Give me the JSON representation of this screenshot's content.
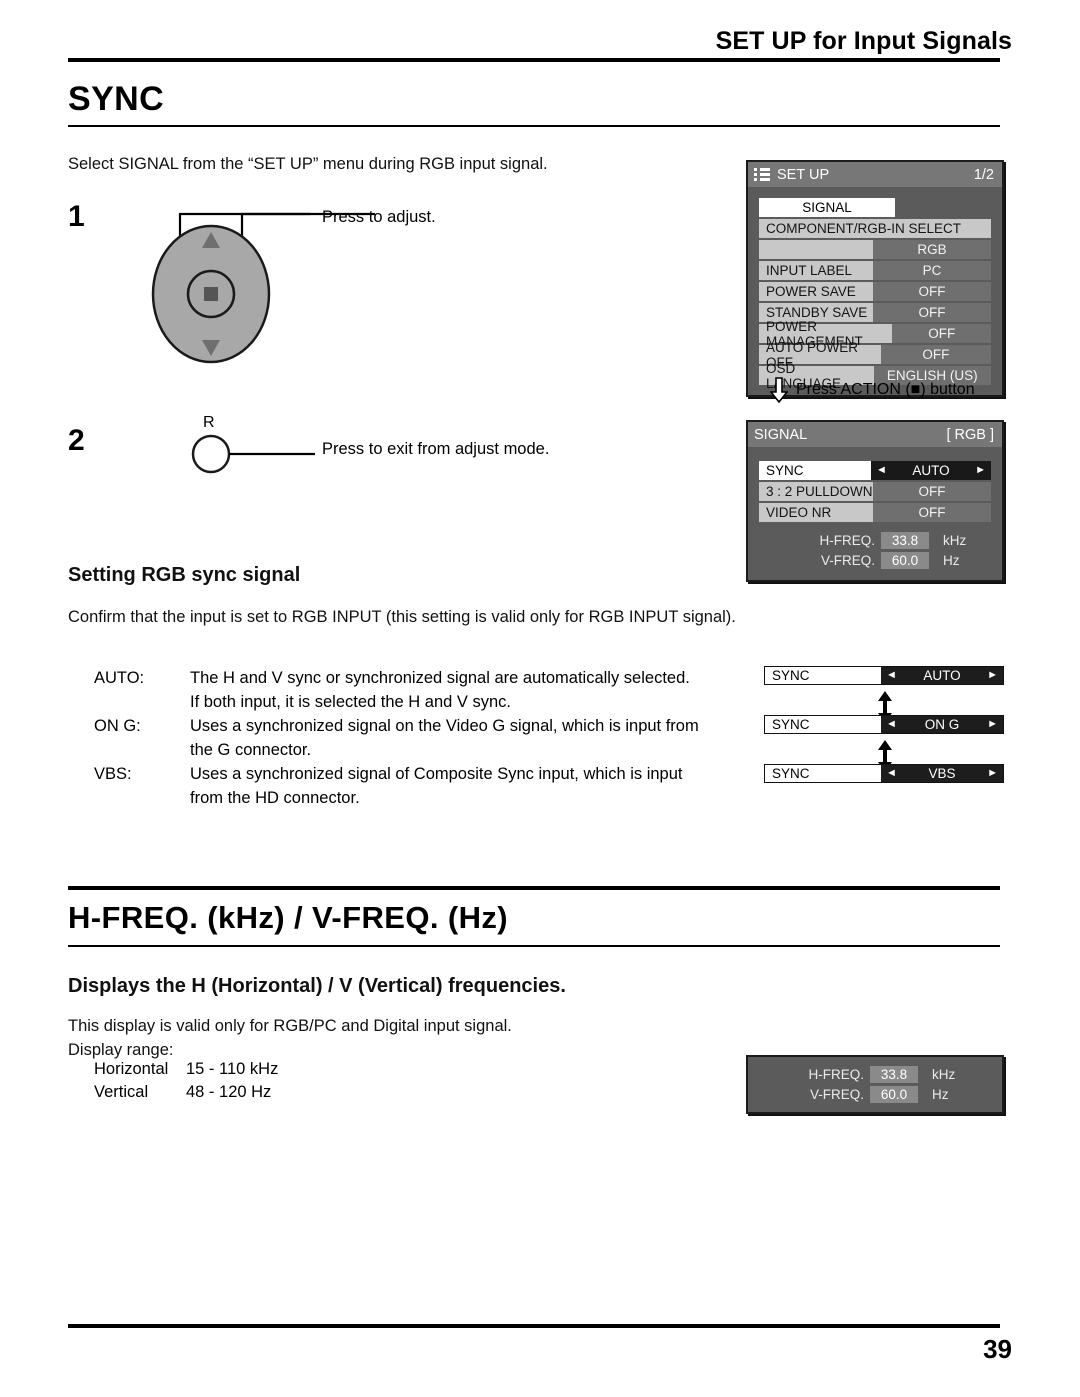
{
  "header": {
    "title": "SET UP for Input Signals"
  },
  "section1": {
    "title": "SYNC",
    "intro": "Select SIGNAL from the “SET UP” menu during RGB input signal.",
    "steps": [
      {
        "number": "1",
        "callout": "Press to adjust."
      },
      {
        "number": "2",
        "callout": "Press to exit from adjust mode.",
        "button_label": "R"
      }
    ]
  },
  "setup_menu": {
    "icon": "list-menu-icon",
    "title": "SET UP",
    "page_indicator": "1/2",
    "highlight_row": "SIGNAL",
    "rows": [
      {
        "label": "COMPONENT/RGB-IN SELECT",
        "value": ""
      },
      {
        "label": "",
        "value": "RGB"
      },
      {
        "label": "INPUT LABEL",
        "value": "PC"
      },
      {
        "label": "POWER SAVE",
        "value": "OFF"
      },
      {
        "label": "STANDBY SAVE",
        "value": "OFF"
      },
      {
        "label": "POWER MANAGEMENT",
        "value": "OFF"
      },
      {
        "label": "AUTO POWER OFF",
        "value": "OFF"
      },
      {
        "label": "OSD LANGUAGE",
        "value": "ENGLISH (US)"
      }
    ]
  },
  "action_note": {
    "arrow": "down-arrow-icon",
    "text": "Press ACTION (■) button"
  },
  "signal_menu": {
    "title": "SIGNAL",
    "input_tag": "[ RGB ]",
    "rows": [
      {
        "label": "SYNC",
        "value": "AUTO",
        "selected": true
      },
      {
        "label": "3 : 2 PULLDOWN",
        "value": "OFF",
        "selected": false
      },
      {
        "label": "VIDEO NR",
        "value": "OFF",
        "selected": false
      }
    ],
    "freq": [
      {
        "label": "H-FREQ.",
        "value": "33.8",
        "unit": "kHz"
      },
      {
        "label": "V-FREQ.",
        "value": "60.0",
        "unit": "Hz"
      }
    ]
  },
  "rgb_sync": {
    "heading": "Setting RGB sync signal",
    "paragraph": "Confirm that the input is set to RGB INPUT (this setting is valid only for RGB INPUT signal).",
    "options": [
      {
        "key": "AUTO:",
        "desc_line1": "The H and V sync or synchronized signal are automatically selected.",
        "desc_line2": "If both input, it is selected the H and V sync."
      },
      {
        "key": "ON G:",
        "desc_line1": "Uses a synchronized signal on the Video G signal, which is input from",
        "desc_line2": "the G connector."
      },
      {
        "key": "VBS:",
        "desc_line1": "Uses a synchronized signal of Composite Sync input, which is input",
        "desc_line2": "from the HD connector."
      }
    ],
    "sync_bars": [
      {
        "label": "SYNC",
        "value": "AUTO"
      },
      {
        "label": "SYNC",
        "value": "ON G"
      },
      {
        "label": "SYNC",
        "value": "VBS"
      }
    ],
    "bar_arrow_left": "◄",
    "bar_arrow_right": "►"
  },
  "section2": {
    "title": "H-FREQ. (kHz) / V-FREQ. (Hz)",
    "subtitle": "Displays the H (Horizontal) / V (Vertical) frequencies.",
    "note": "This display is valid only for RGB/PC and Digital input signal.",
    "range_label": "Display range:",
    "ranges": [
      {
        "key": "Horizontal",
        "value": "15 - 110 kHz"
      },
      {
        "key": "Vertical",
        "value": "48 - 120 Hz"
      }
    ],
    "freq_panel": [
      {
        "label": "H-FREQ.",
        "value": "33.8",
        "unit": "kHz"
      },
      {
        "label": "V-FREQ.",
        "value": "60.0",
        "unit": "Hz"
      }
    ]
  },
  "footer": {
    "page_number": "39"
  },
  "colors": {
    "osd_bg": "#5b5b5b",
    "osd_header": "#777777",
    "row_label": "#c8c8c8",
    "row_value": "#6f6f6f",
    "selected_value": "#191919"
  }
}
